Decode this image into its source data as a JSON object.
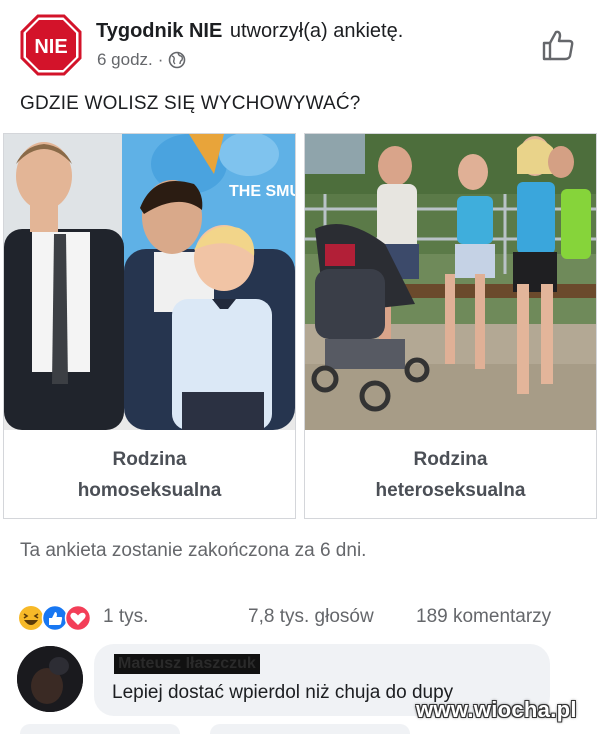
{
  "post": {
    "page_name": "Tygodnik NIE",
    "action": "utworzył(a) ankietę.",
    "time": "6 godz.",
    "separator": "·",
    "logo_text": "NIE",
    "privacy_icon": "globe-icon",
    "like_icon": "thumbs-up-icon"
  },
  "poll": {
    "question": "GDZIE WOLISZ SIĘ WYCHOWYWAĆ?",
    "options": [
      {
        "line1": "Rodzina",
        "line2": "homoseksualna",
        "image_text": "THE SMUR"
      },
      {
        "line1": "Rodzina",
        "line2": "heteroseksualna"
      }
    ],
    "closing_note": "Ta ankieta zostanie zakończona za 6 dni."
  },
  "stats": {
    "reactions_icons": [
      "haha-icon",
      "like-icon",
      "love-icon"
    ],
    "reactions_count": "1 tys.",
    "votes": "7,8 tys. głosów",
    "comments": "189 komentarzy"
  },
  "comment": {
    "author": "Mateusz Iłaszczuk",
    "text": "Lepiej dostać wpierdol niż chuja do dupy"
  },
  "watermark": "www.wiocha.pl",
  "colors": {
    "nie_red": "#d3132a",
    "link_gray": "#65676b",
    "like_blue": "#1877f2",
    "love_red": "#f33e58",
    "haha_yellow": "#f7b928"
  }
}
